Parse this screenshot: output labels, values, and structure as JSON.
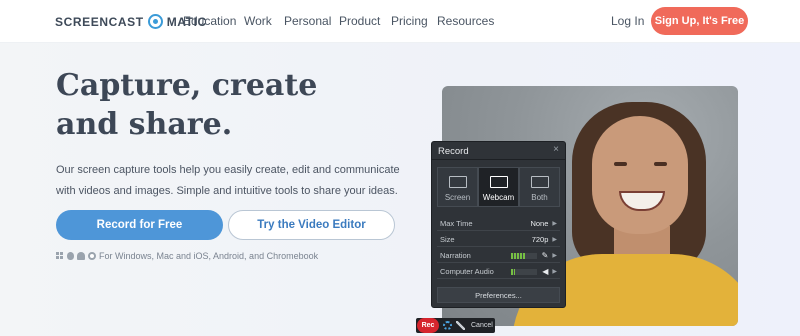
{
  "nav": {
    "logo_left": "SCREENCAST",
    "logo_right": "MATIC",
    "links": [
      "Education",
      "Work",
      "Personal",
      "Product",
      "Pricing",
      "Resources"
    ],
    "login": "Log In",
    "signup": "Sign Up, It's Free"
  },
  "hero": {
    "headline": "Capture, create and share.",
    "description": "Our screen capture tools help you easily create, edit and communicate with videos and images. Simple and intuitive tools to share your ideas.",
    "primary_button": "Record for Free",
    "secondary_button": "Try the Video Editor",
    "platforms_text": "For Windows, Mac and iOS, Android, and Chromebook"
  },
  "record_panel": {
    "title": "Record",
    "close": "×",
    "modes": [
      {
        "label": "Screen",
        "active": false
      },
      {
        "label": "Webcam",
        "active": true
      },
      {
        "label": "Both",
        "active": false
      }
    ],
    "settings": [
      {
        "label": "Max Time",
        "value": "None"
      },
      {
        "label": "Size",
        "value": "720p"
      },
      {
        "label": "Narration",
        "value": ""
      },
      {
        "label": "Computer Audio",
        "value": ""
      }
    ],
    "narration_level": 0.55,
    "computer_audio_level": 0.15,
    "preferences": "Preferences..."
  },
  "record_bar": {
    "rec": "Rec",
    "cancel": "Cancel"
  },
  "colors": {
    "brand_blue": "#4e96d8",
    "signup_red": "#f06a5a",
    "rec_red": "#d6252e"
  }
}
